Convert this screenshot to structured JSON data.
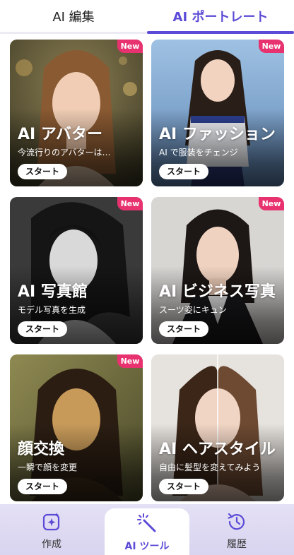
{
  "tabs": {
    "left": "AI 編集",
    "right": "AI ポートレート",
    "active": "right"
  },
  "cards": [
    {
      "title": "AI アバター",
      "subtitle": "今流行りのアバターは…",
      "badge": "New",
      "button": "スタート"
    },
    {
      "title": "AI ファッション",
      "subtitle": "AI で服装をチェンジ",
      "badge": "New",
      "button": "スタート"
    },
    {
      "title": "AI 写真館",
      "subtitle": "モデル写真を生成",
      "badge": "New",
      "button": "スタート"
    },
    {
      "title": "AI ビジネス写真",
      "subtitle": "スーツ姿にキュン",
      "badge": "New",
      "button": "スタート"
    },
    {
      "title": "顔交換",
      "subtitle": "一瞬で顔を変更",
      "badge": "New",
      "button": "スタート"
    },
    {
      "title": "AI ヘアスタイル",
      "subtitle": "自由に髪型を変えてみよう",
      "button": "スタート"
    }
  ],
  "bottom_nav": {
    "create": {
      "label": "作成",
      "icon": "sparkle-square-icon"
    },
    "tools": {
      "label": "AI ツール",
      "icon": "magic-wand-icon",
      "active": true
    },
    "history": {
      "label": "履歴",
      "icon": "history-clock-icon"
    }
  },
  "colors": {
    "accent": "#5b4bd6",
    "badge": "#e8326f",
    "nav_bg": "#e4e0f5"
  }
}
